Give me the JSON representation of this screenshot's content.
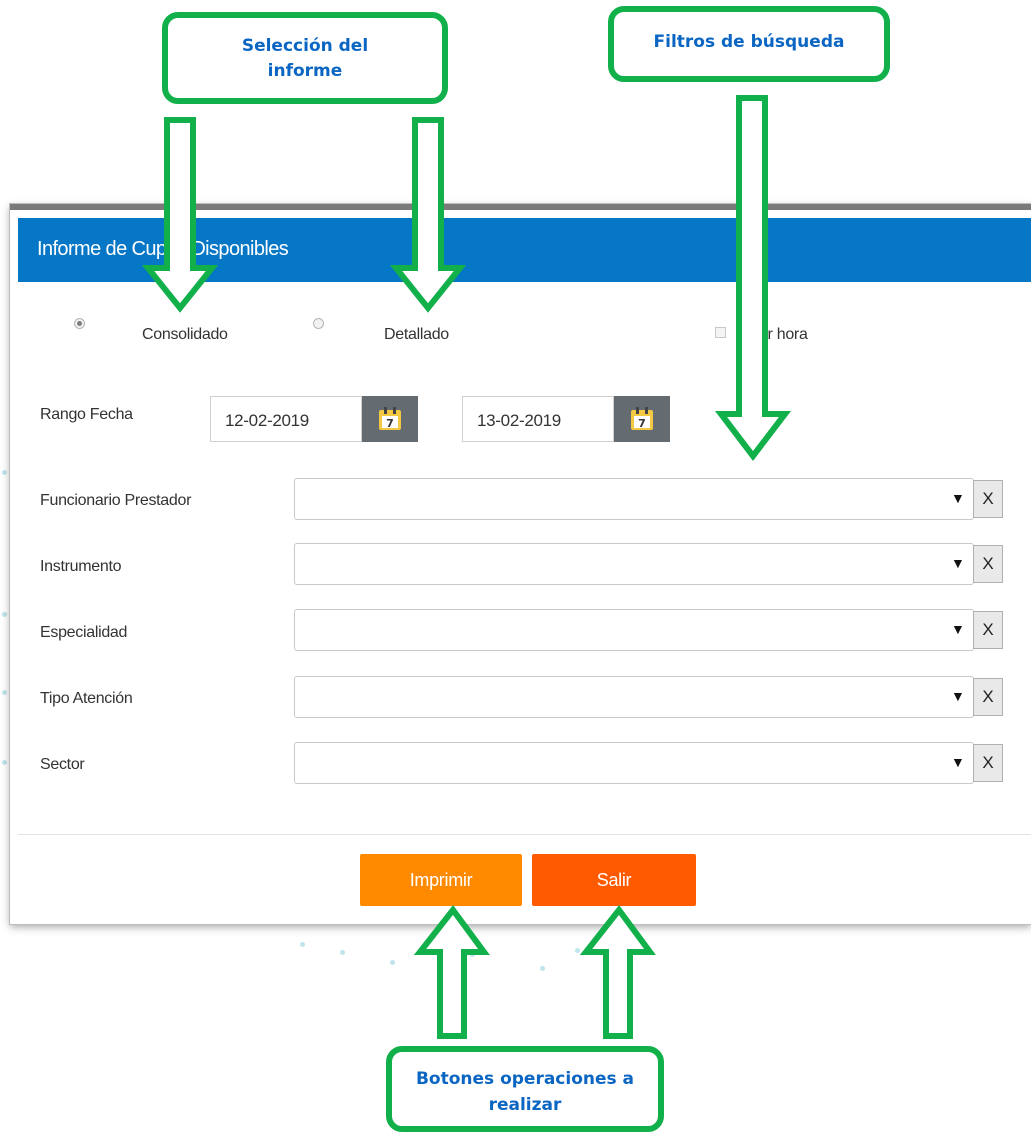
{
  "annotations": {
    "report_selection": "Selección del informe",
    "search_filters": "Filtros de búsqueda",
    "action_buttons": "Botones operaciones a realizar"
  },
  "dialog": {
    "title": "Informe de Cupos Disponibles",
    "options": {
      "consolidado": "Consolidado",
      "detallado": "Detallado",
      "selected": "consolidado",
      "usar_hora": "Usar hora",
      "usar_hora_checked": false
    },
    "date_range": {
      "label": "Rango Fecha",
      "from": "12-02-2019",
      "to": "13-02-2019",
      "calendar_day": "7"
    },
    "filters": [
      {
        "label": "Funcionario Prestador",
        "value": "",
        "clear": "X"
      },
      {
        "label": "Instrumento",
        "value": "",
        "clear": "X"
      },
      {
        "label": "Especialidad",
        "value": "",
        "clear": "X"
      },
      {
        "label": "Tipo Atención",
        "value": "",
        "clear": "X"
      },
      {
        "label": "Sector",
        "value": "",
        "clear": "X"
      }
    ],
    "buttons": {
      "print": "Imprimir",
      "exit": "Salir"
    }
  },
  "colors": {
    "header_bg": "#0676c6",
    "annotation_green": "#12b04a",
    "annotation_text": "#0a66c2",
    "print_button": "#ff8a00",
    "exit_button": "#ff5a00",
    "calendar_button": "#646c72"
  },
  "icons": [
    "calendar-icon",
    "dropdown-caret-icon",
    "clear-icon",
    "arrow-down-icon",
    "arrow-up-icon"
  ]
}
